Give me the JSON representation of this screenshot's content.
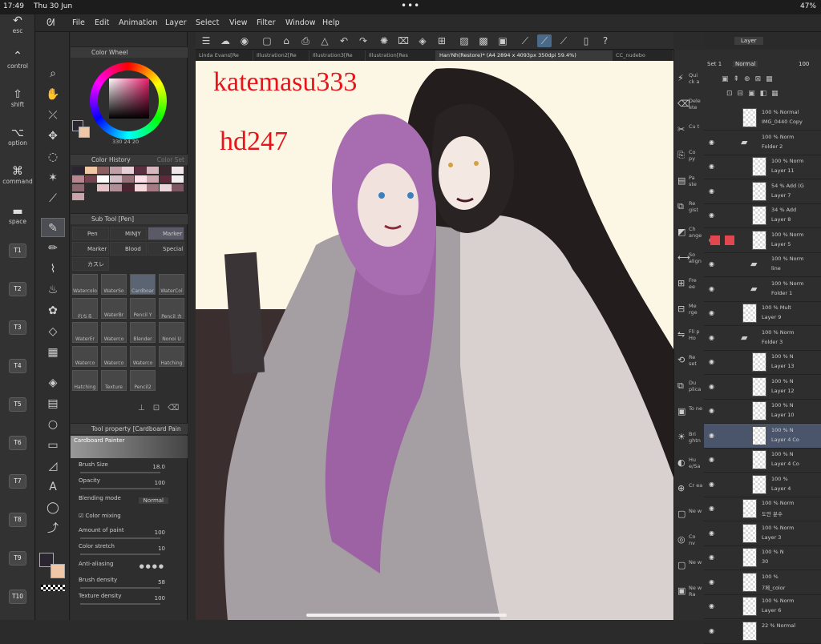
{
  "status": {
    "time": "17:49",
    "date": "Thu 30 Jun",
    "dots": "•••",
    "right": "47%"
  },
  "menu": [
    "File",
    "Edit",
    "Animation",
    "Layer",
    "Select",
    "View",
    "Filter",
    "Window",
    "Help"
  ],
  "leftstrip": [
    {
      "label": "esc",
      "glyph": "↶"
    },
    {
      "label": "control",
      "glyph": "⌃"
    },
    {
      "label": "shift",
      "glyph": "⇧"
    },
    {
      "label": "option",
      "glyph": "⌥"
    },
    {
      "label": "command",
      "glyph": "⌘"
    },
    {
      "label": "space",
      "glyph": "▬"
    }
  ],
  "tkeys": [
    "T1",
    "T2",
    "T3",
    "T4",
    "T5",
    "T6",
    "T7",
    "T8",
    "T9",
    "T10"
  ],
  "color_wheel": {
    "title": "Color Wheel",
    "values": [
      "330",
      "24",
      "20"
    ]
  },
  "color_history": {
    "title": "Color History",
    "set": "Color Set",
    "colors": [
      "#2a2530",
      "#f0c8a8",
      "#8a6060",
      "#c0a0a8",
      "#e8d0d8",
      "#5a3040",
      "#d8b8c0",
      "#3a2a30",
      "#efe6e9",
      "#b88590",
      "#76444e",
      "#ffffff",
      "#d4c0c6",
      "#9a7078",
      "#ffe0e8",
      "#cfa8b0",
      "#602838",
      "#f5f0f0",
      "#8c6a72",
      "#2e2e2e",
      "#e4c4c8",
      "#b09098",
      "#4a2630",
      "#f4d8dc",
      "#a47a84",
      "#ead6da",
      "#7c5862",
      "#c8a4ac"
    ]
  },
  "sub_tool": {
    "title": "Sub Tool [Pen]",
    "items": [
      "Pen",
      "MINJY",
      "Marker",
      "Marker",
      "Blood",
      "Special",
      "カスレ"
    ],
    "brushes": [
      "Watercolor",
      "WaterSo",
      "Cardboar",
      "WaterCol",
      "れちる",
      "WaterBr",
      "Pencil Y",
      "Pencil カ",
      "WaterEr",
      "Waterco",
      "Blender",
      "Nonoi U",
      "Waterco",
      "Waterco",
      "Waterco",
      "Hatching",
      "Hatching",
      "Texture",
      "Pencil2"
    ]
  },
  "tool_property": {
    "title": "Tool property [Cardboard Pain",
    "brush": "Cardboard Painter",
    "brush_size_label": "Brush Size",
    "brush_size": "18.0",
    "opacity_label": "Opacity",
    "opacity": "100",
    "blending_label": "Blending mode",
    "blending": "Normal",
    "color_mixing": "Color mixing",
    "amount_label": "Amount of paint",
    "amount": "100",
    "stretch_label": "Color stretch",
    "stretch": "10",
    "aa_label": "Anti-aliasing",
    "density_label": "Brush density",
    "density": "58",
    "texture_label": "Texture density",
    "texture": "100"
  },
  "tabs": [
    "Linda Evans[Re",
    "Illustration2[Re",
    "Illustration3[Re",
    "Illustration[Res",
    "Han'Nh(Restore)* (A4 2894 x 4093px 350dpi 59.4%)",
    "CC_nudebo"
  ],
  "watermark": [
    "katemasu333",
    "hd247"
  ],
  "commands": [
    "Qui ck a",
    "Dele ete",
    "Cu t",
    "Co py",
    "Pa ste",
    "Re gist",
    "Ch ange",
    "So align",
    "Fre ee",
    "Me rge",
    "Fli p Ho",
    "Re set",
    "Du plica",
    "To ne",
    "Bri ghtn",
    "Hu e/Sa",
    "Cr ea",
    "Ne w",
    "Co nv",
    "Ne w",
    "Ne w Ra"
  ],
  "layer_panel": {
    "tab": "Layer",
    "set": "Set 1",
    "mode": "Normal",
    "opacity": "100"
  },
  "layers": [
    {
      "m": "100 % Normal",
      "n": "IMG_0440 Copy"
    },
    {
      "m": "100 % Norm",
      "n": "Folder 2"
    },
    {
      "m": "100 % Norm",
      "n": "Layer 11"
    },
    {
      "m": "54 % Add (G",
      "n": "Layer 7"
    },
    {
      "m": "34 % Add",
      "n": "Layer 8"
    },
    {
      "m": "100 % Norm",
      "n": "Layer 5"
    },
    {
      "m": "100 % Norm",
      "n": "line"
    },
    {
      "m": "100 % Norm",
      "n": "Folder 1"
    },
    {
      "m": "100 % Mult",
      "n": "Layer 9"
    },
    {
      "m": "100 % Norm",
      "n": "Folder 3"
    },
    {
      "m": "100 % N",
      "n": "Layer 13"
    },
    {
      "m": "100 % N",
      "n": "Layer 12"
    },
    {
      "m": "100 % N",
      "n": "Layer 10"
    },
    {
      "m": "100 % N",
      "n": "Layer 4 Co"
    },
    {
      "m": "100 % N",
      "n": "Layer 4 Co"
    },
    {
      "m": "100 %",
      "n": "Layer 4"
    },
    {
      "m": "100 % Norm",
      "n": "도안 분수"
    },
    {
      "m": "100 % Norm",
      "n": "Layer 3"
    },
    {
      "m": "100 % N",
      "n": "30"
    },
    {
      "m": "100 %",
      "n": "7페_color"
    },
    {
      "m": "100 % Norm",
      "n": "Layer 6"
    },
    {
      "m": "22 % Normal",
      "n": ""
    }
  ]
}
